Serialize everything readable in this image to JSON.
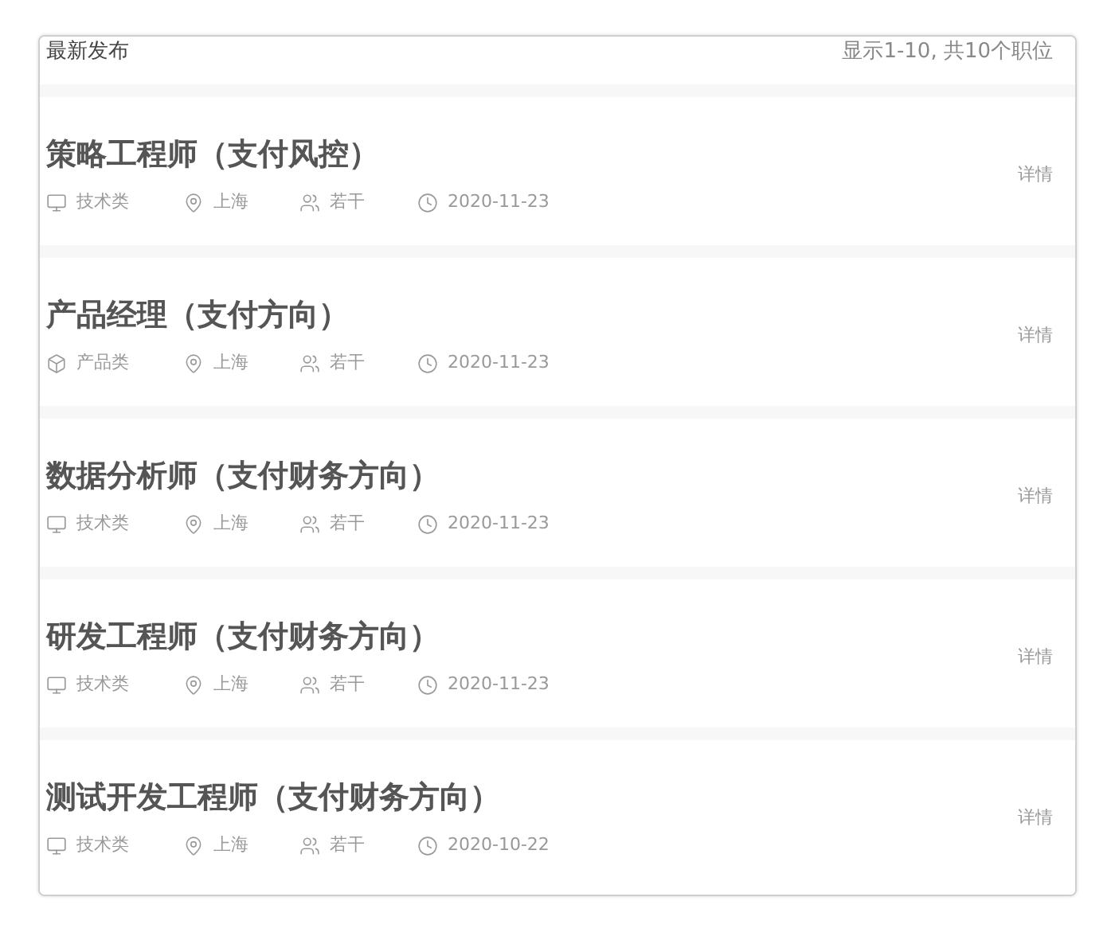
{
  "header": {
    "title": "最新发布",
    "summary": "显示1-10, 共10个职位"
  },
  "jobs": [
    {
      "title": "策略工程师（支付风控）",
      "category": {
        "kind": "tech",
        "label": "技术类"
      },
      "location": "上海",
      "headcount": "若干",
      "date": "2020-11-23",
      "link": "详情"
    },
    {
      "title": "产品经理（支付方向）",
      "category": {
        "kind": "product",
        "label": "产品类"
      },
      "location": "上海",
      "headcount": "若干",
      "date": "2020-11-23",
      "link": "详情"
    },
    {
      "title": "数据分析师（支付财务方向）",
      "category": {
        "kind": "tech",
        "label": "技术类"
      },
      "location": "上海",
      "headcount": "若干",
      "date": "2020-11-23",
      "link": "详情"
    },
    {
      "title": "研发工程师（支付财务方向）",
      "category": {
        "kind": "tech",
        "label": "技术类"
      },
      "location": "上海",
      "headcount": "若干",
      "date": "2020-11-23",
      "link": "详情"
    },
    {
      "title": "测试开发工程师（支付财务方向）",
      "category": {
        "kind": "tech",
        "label": "技术类"
      },
      "location": "上海",
      "headcount": "若干",
      "date": "2020-10-22",
      "link": "详情"
    }
  ]
}
